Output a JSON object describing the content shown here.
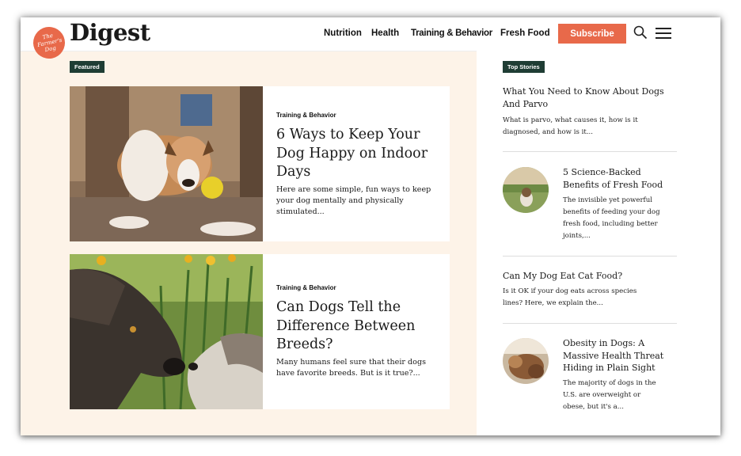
{
  "header": {
    "logo_text": "The Farmer's Dog",
    "brand": "Digest",
    "nav": [
      "Nutrition",
      "Health",
      "Training & Behavior",
      "Fresh Food"
    ],
    "subscribe_label": "Subscribe"
  },
  "featured": {
    "tag": "Featured",
    "articles": [
      {
        "category": "Training & Behavior",
        "title": "6 Ways to Keep Your Dog Happy on Indoor Days",
        "description": "Here are some simple, fun ways to keep your dog mentally and physically stimulated..."
      },
      {
        "category": "Training & Behavior",
        "title": "Can Dogs Tell the Difference Between Breeds?",
        "description": "Many humans feel sure that their dogs have favorite breeds. But is it true?..."
      }
    ]
  },
  "top_stories": {
    "tag": "Top Stories",
    "items": [
      {
        "title": "What You Need to Know About Dogs And Parvo",
        "description": "What is parvo, what causes it, how is it diagnosed, and how is it..."
      },
      {
        "title": "5 Science-Backed Benefits of Fresh Food",
        "description": "The invisible yet powerful benefits of feeding your dog fresh food, including better joints,..."
      },
      {
        "title": "Can My Dog Eat Cat Food?",
        "description": "Is it OK if your dog eats across species lines? Here, we explain the..."
      },
      {
        "title": "Obesity in Dogs: A Massive Health Threat Hiding in Plain Sight",
        "description": "The majority of dogs in the U.S. are overweight or obese, but it's a..."
      }
    ]
  },
  "colors": {
    "accent": "#e8694a",
    "tag_bg": "#1f3d34",
    "page_bg": "#fdf3e8"
  }
}
